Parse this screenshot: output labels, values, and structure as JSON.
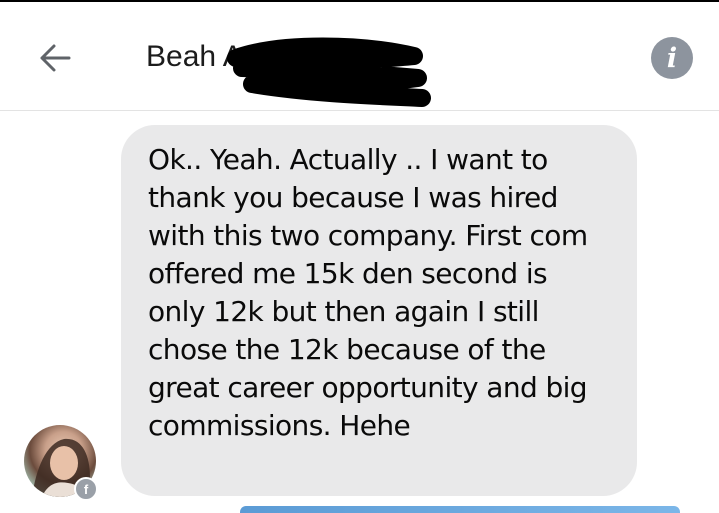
{
  "header": {
    "contact_name": "Beah A",
    "back_icon": "arrow-left-icon",
    "info_icon": "info-icon",
    "info_glyph": "i"
  },
  "thread": {
    "messages": [
      {
        "text": "Ok.. Yeah. Actually .. I want to thank you because I was hired with this two company. First com offered me 15k den second is only 12k but then again I still chose the 12k because of the great career opportunity and big commissions. Hehe"
      }
    ],
    "avatar_badge_glyph": "f"
  },
  "colors": {
    "bubble_background": "#e9e9ea",
    "info_button": "#8d949e",
    "redaction": "#000000"
  }
}
